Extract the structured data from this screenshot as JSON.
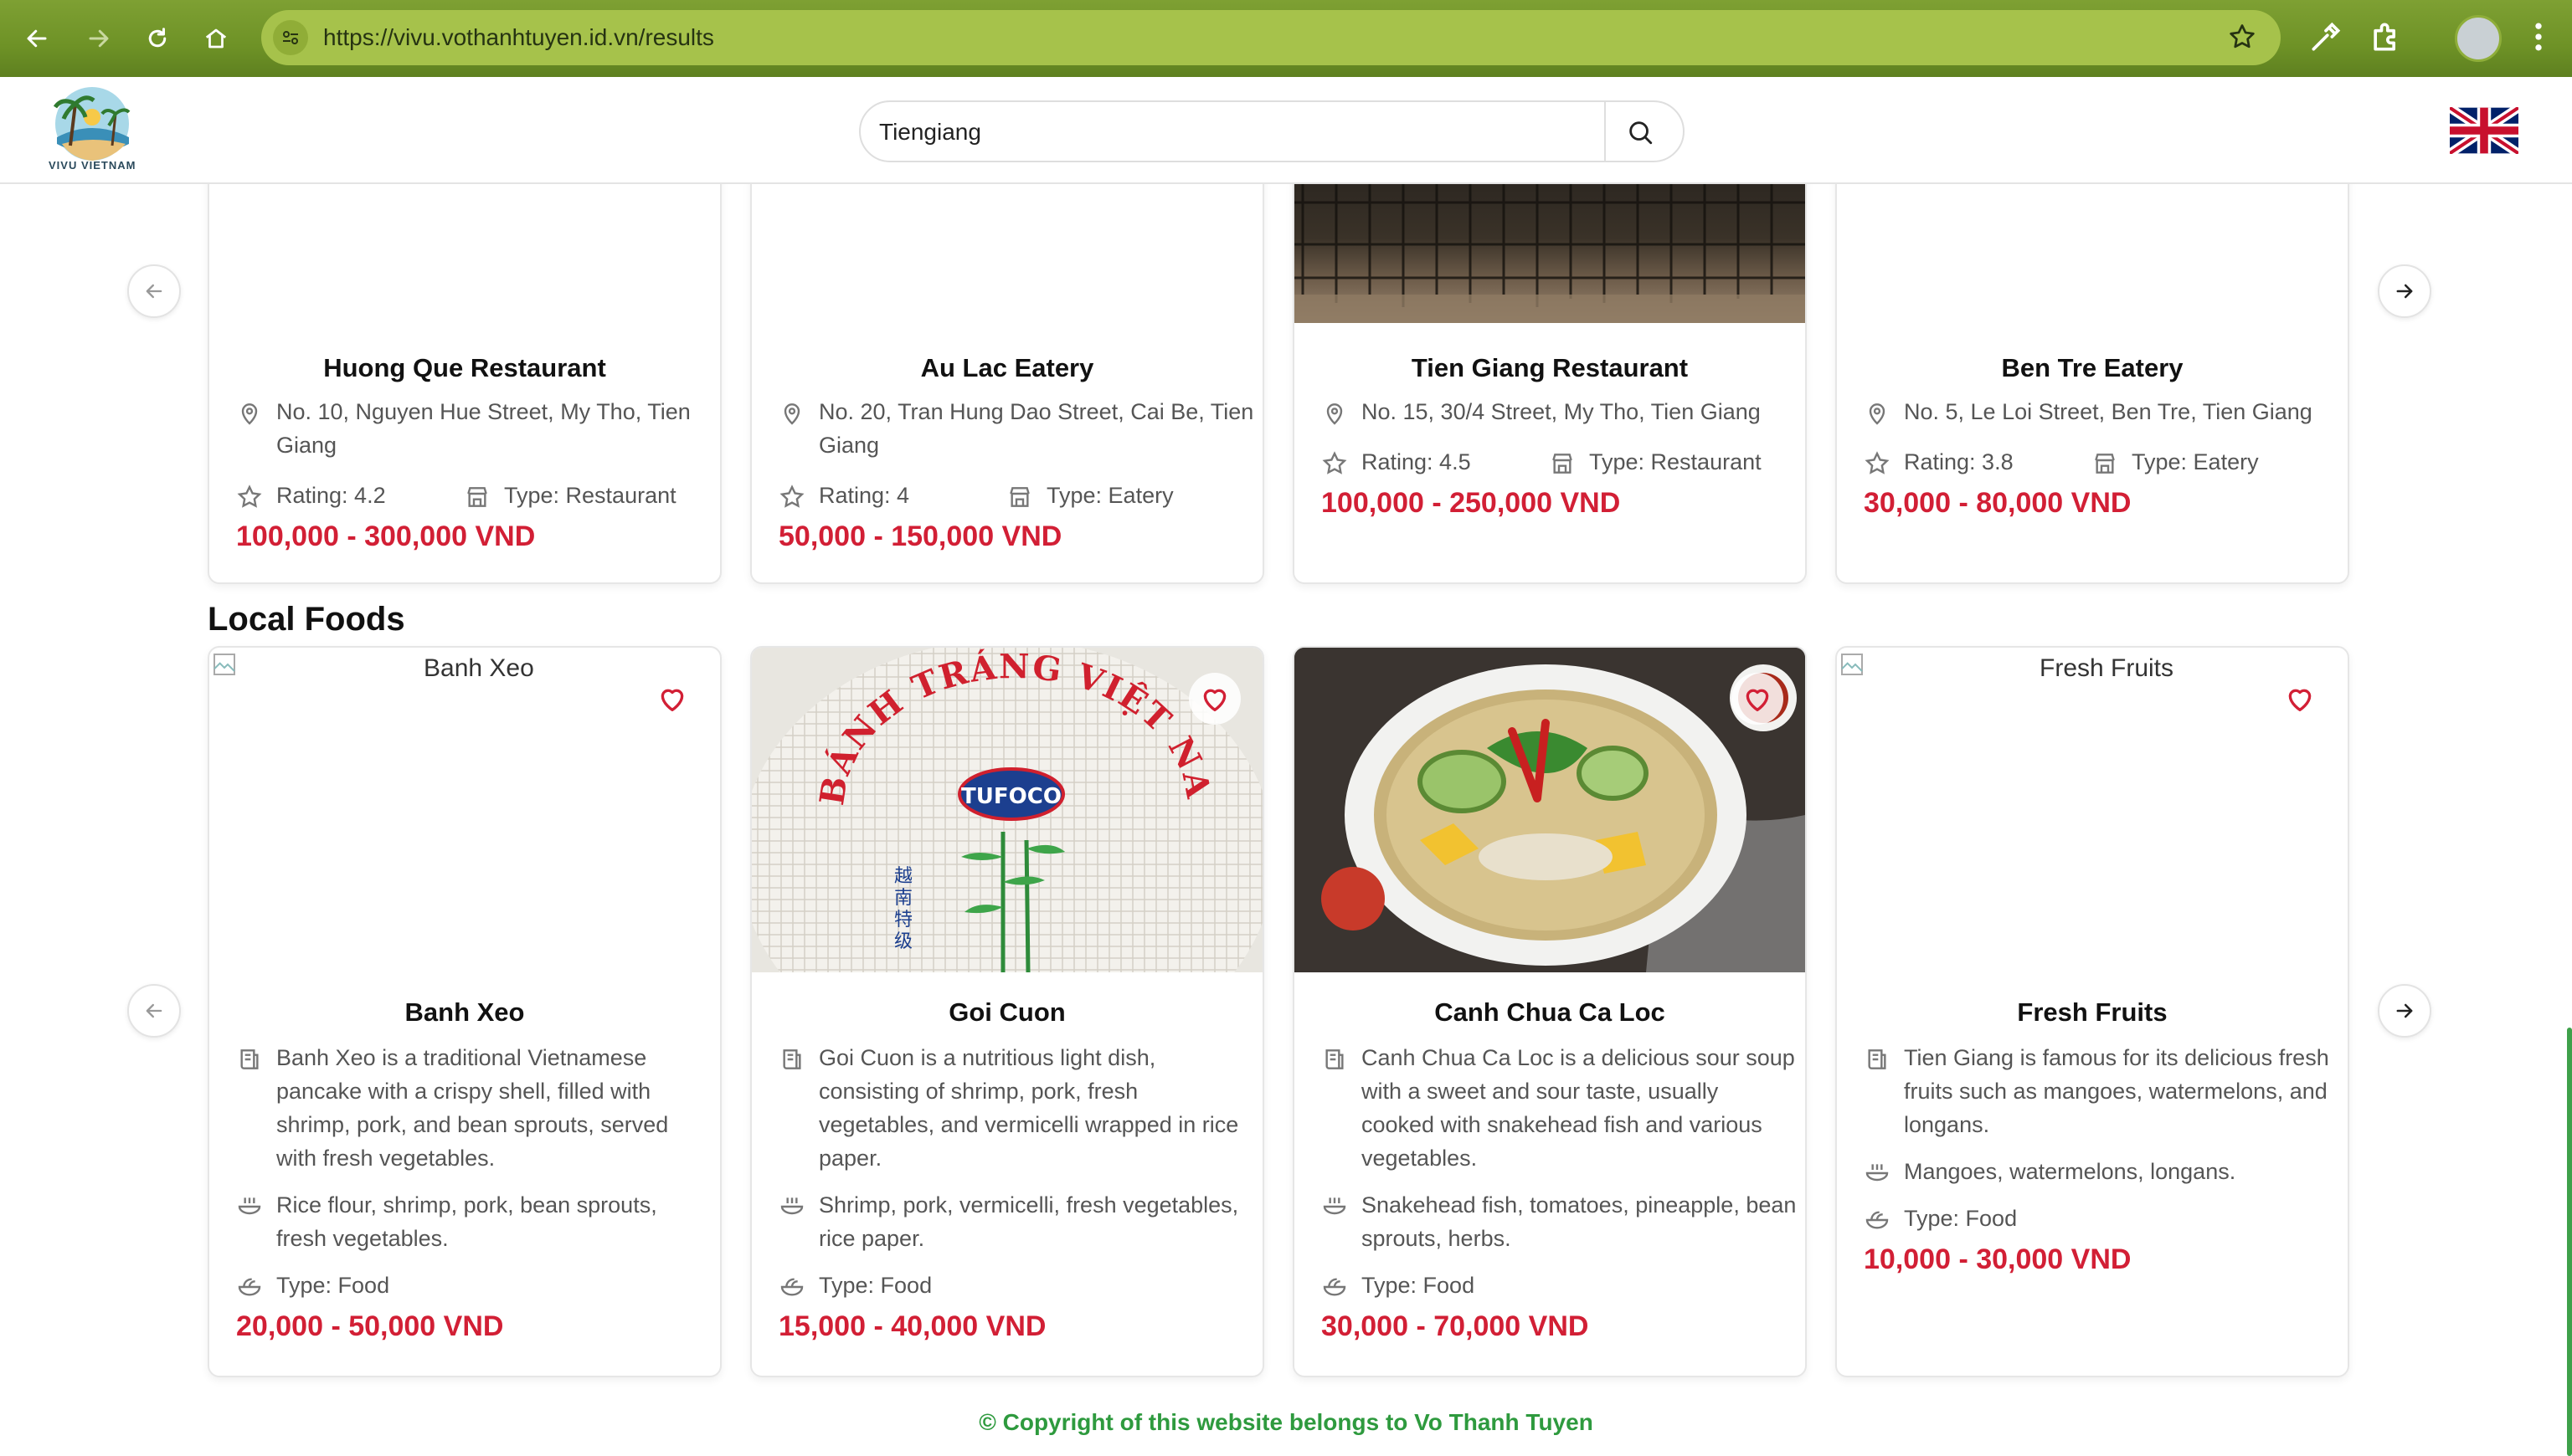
{
  "browser": {
    "url": "https://vivu.vothanhtuyen.id.vn/results"
  },
  "header": {
    "logo_text": "VIVU VIETNAM",
    "search_value": "Tiengiang"
  },
  "restaurants": [
    {
      "name": "Huong Que Restaurant",
      "address": "No. 10, Nguyen Hue Street, My Tho, Tien Giang",
      "rating": "Rating: 4.2",
      "type": "Type: Restaurant",
      "price": "100,000 - 300,000 VND"
    },
    {
      "name": "Au Lac Eatery",
      "address": "No. 20, Tran Hung Dao Street, Cai Be, Tien Giang",
      "rating": "Rating: 4",
      "type": "Type: Eatery",
      "price": "50,000 - 150,000 VND"
    },
    {
      "name": "Tien Giang Restaurant",
      "address": "No. 15, 30/4 Street, My Tho, Tien Giang",
      "rating": "Rating: 4.5",
      "type": "Type: Restaurant",
      "price": "100,000 - 250,000 VND"
    },
    {
      "name": "Ben Tre Eatery",
      "address": "No. 5, Le Loi Street, Ben Tre, Tien Giang",
      "rating": "Rating: 3.8",
      "type": "Type: Eatery",
      "price": "30,000 - 80,000 VND"
    }
  ],
  "local_foods": {
    "title": "Local Foods",
    "items": [
      {
        "name": "Banh Xeo",
        "alt": "Banh Xeo",
        "description": "Banh Xeo is a traditional Vietnamese pancake with a crispy shell, filled with shrimp, pork, and bean sprouts, served with fresh vegetables.",
        "ingredients": "Rice flour, shrimp, pork, bean sprouts, fresh vegetables.",
        "type": "Type: Food",
        "price": "20,000 - 50,000 VND"
      },
      {
        "name": "Goi Cuon",
        "alt": "Goi Cuon",
        "image_text": "BÁNH TRÁNG VIỆT NAM",
        "image_brand": "TUFOCO",
        "description": "Goi Cuon is a nutritious light dish, consisting of shrimp, pork, fresh vegetables, and vermicelli wrapped in rice paper.",
        "ingredients": "Shrimp, pork, vermicelli, fresh vegetables, rice paper.",
        "type": "Type: Food",
        "price": "15,000 - 40,000 VND"
      },
      {
        "name": "Canh Chua Ca Loc",
        "alt": "Canh Chua Ca Loc",
        "description": "Canh Chua Ca Loc is a delicious sour soup with a sweet and sour taste, usually cooked with snakehead fish and various vegetables.",
        "ingredients": "Snakehead fish, tomatoes, pineapple, bean sprouts, herbs.",
        "type": "Type: Food",
        "price": "30,000 - 70,000 VND"
      },
      {
        "name": "Fresh Fruits",
        "alt": "Fresh Fruits",
        "description": "Tien Giang is famous for its delicious fresh fruits such as mangoes, watermelons, and longans.",
        "ingredients": "Mangoes, watermelons, longans.",
        "type": "Type: Food",
        "price": "10,000 - 30,000 VND"
      }
    ]
  },
  "footer": {
    "copyright": "© Copyright of this website belongs to Vo Thanh Tuyen"
  },
  "colors": {
    "price": "#d21f35",
    "footer": "#2e9a3e",
    "browser_bar": "#6e9226"
  }
}
